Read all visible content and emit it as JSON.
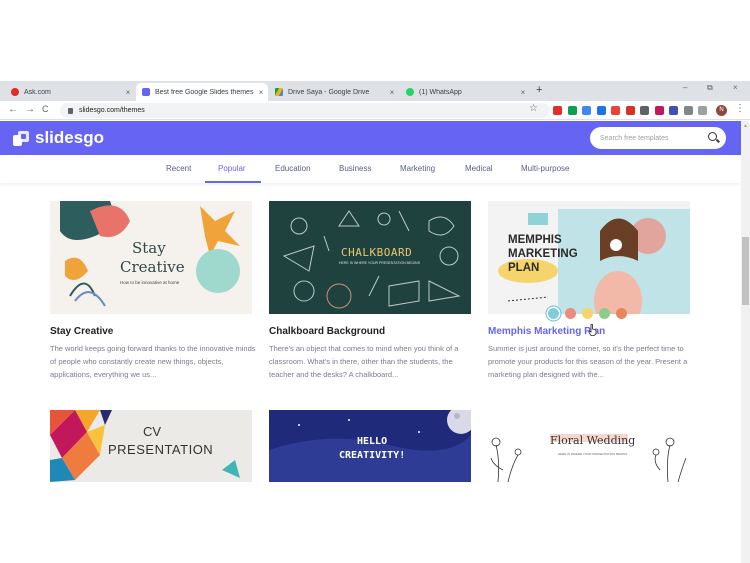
{
  "browser": {
    "tabs": [
      {
        "title": "Ask.com",
        "favicon_color": "#e12a2a",
        "active": false
      },
      {
        "title": "Best free Google Slides themes and",
        "favicon_color": "#6664f2",
        "active": true
      },
      {
        "title": "Drive Saya - Google Drive",
        "favicon_color": "#f4b400",
        "active": false
      },
      {
        "title": "(1) WhatsApp",
        "favicon_color": "#25d366",
        "active": false
      }
    ],
    "close_glyph": "×",
    "new_tab_glyph": "+",
    "window_controls": [
      "–",
      "⧉",
      "×"
    ],
    "nav": {
      "back": "←",
      "forward": "→",
      "reload": "C"
    },
    "url": "slidesgo.com/themes",
    "bookmark_star": "☆",
    "extension_colors": [
      "#e52d27",
      "#0f9d58",
      "#4285f4",
      "#1a73e8",
      "#ea4335",
      "#d93025",
      "#5f6368",
      "#c2185b",
      "#3f51b5",
      "#80868b",
      "#9aa0a6"
    ],
    "profile_initial": "N",
    "menu_glyph": "⋮"
  },
  "site": {
    "logo_text": "slidesgo",
    "search_placeholder": "Search free templates",
    "categories": [
      "Recent",
      "Popular",
      "Education",
      "Business",
      "Marketing",
      "Medical",
      "Multi-purpose"
    ],
    "active_category": "Popular",
    "brand_color": "#6664f2"
  },
  "cards": [
    {
      "title": "Stay Creative",
      "description": "The world keeps going forward thanks to the innovative minds of people who constantly create new things, objects, applications, everything we us...",
      "thumb": {
        "heading1": "Stay",
        "heading2": "Creative",
        "subtitle": "How to be innovative at home"
      }
    },
    {
      "title": "Chalkboard Background",
      "description": "There's an object that comes to mind when you think of a classroom. What's in there, other than the students, the teacher and the desks? A chalkboard...",
      "thumb": {
        "heading": "CHALKBOARD",
        "subtitle": "HERE IS WHERE YOUR PRESENTATION BEGINS"
      }
    },
    {
      "title": "Memphis Marketing Plan",
      "description": "Summer is just around the corner, so it's the perfect time to promote your products for this season of the year. Present a marketing plan designed with the...",
      "thumb": {
        "line1": "MEMPHIS",
        "line2": "MARKETING",
        "line3": "PLAN"
      },
      "color_options": [
        "#7ecfd9",
        "#f08a7e",
        "#f7d46b",
        "#8ccc8a",
        "#e8875c"
      ]
    },
    {
      "title": "CV Presentation",
      "thumb": {
        "line1": "CV",
        "line2": "PRESENTATION"
      }
    },
    {
      "title": "Hello Creativity",
      "thumb": {
        "line1": "HELLO",
        "line2": "CREATIVITY!"
      }
    },
    {
      "title": "Floral Wedding",
      "thumb": {
        "heading": "Floral Wedding",
        "subtitle": "HERE IS WHERE YOUR PRESENTATION BEGINS"
      }
    }
  ]
}
